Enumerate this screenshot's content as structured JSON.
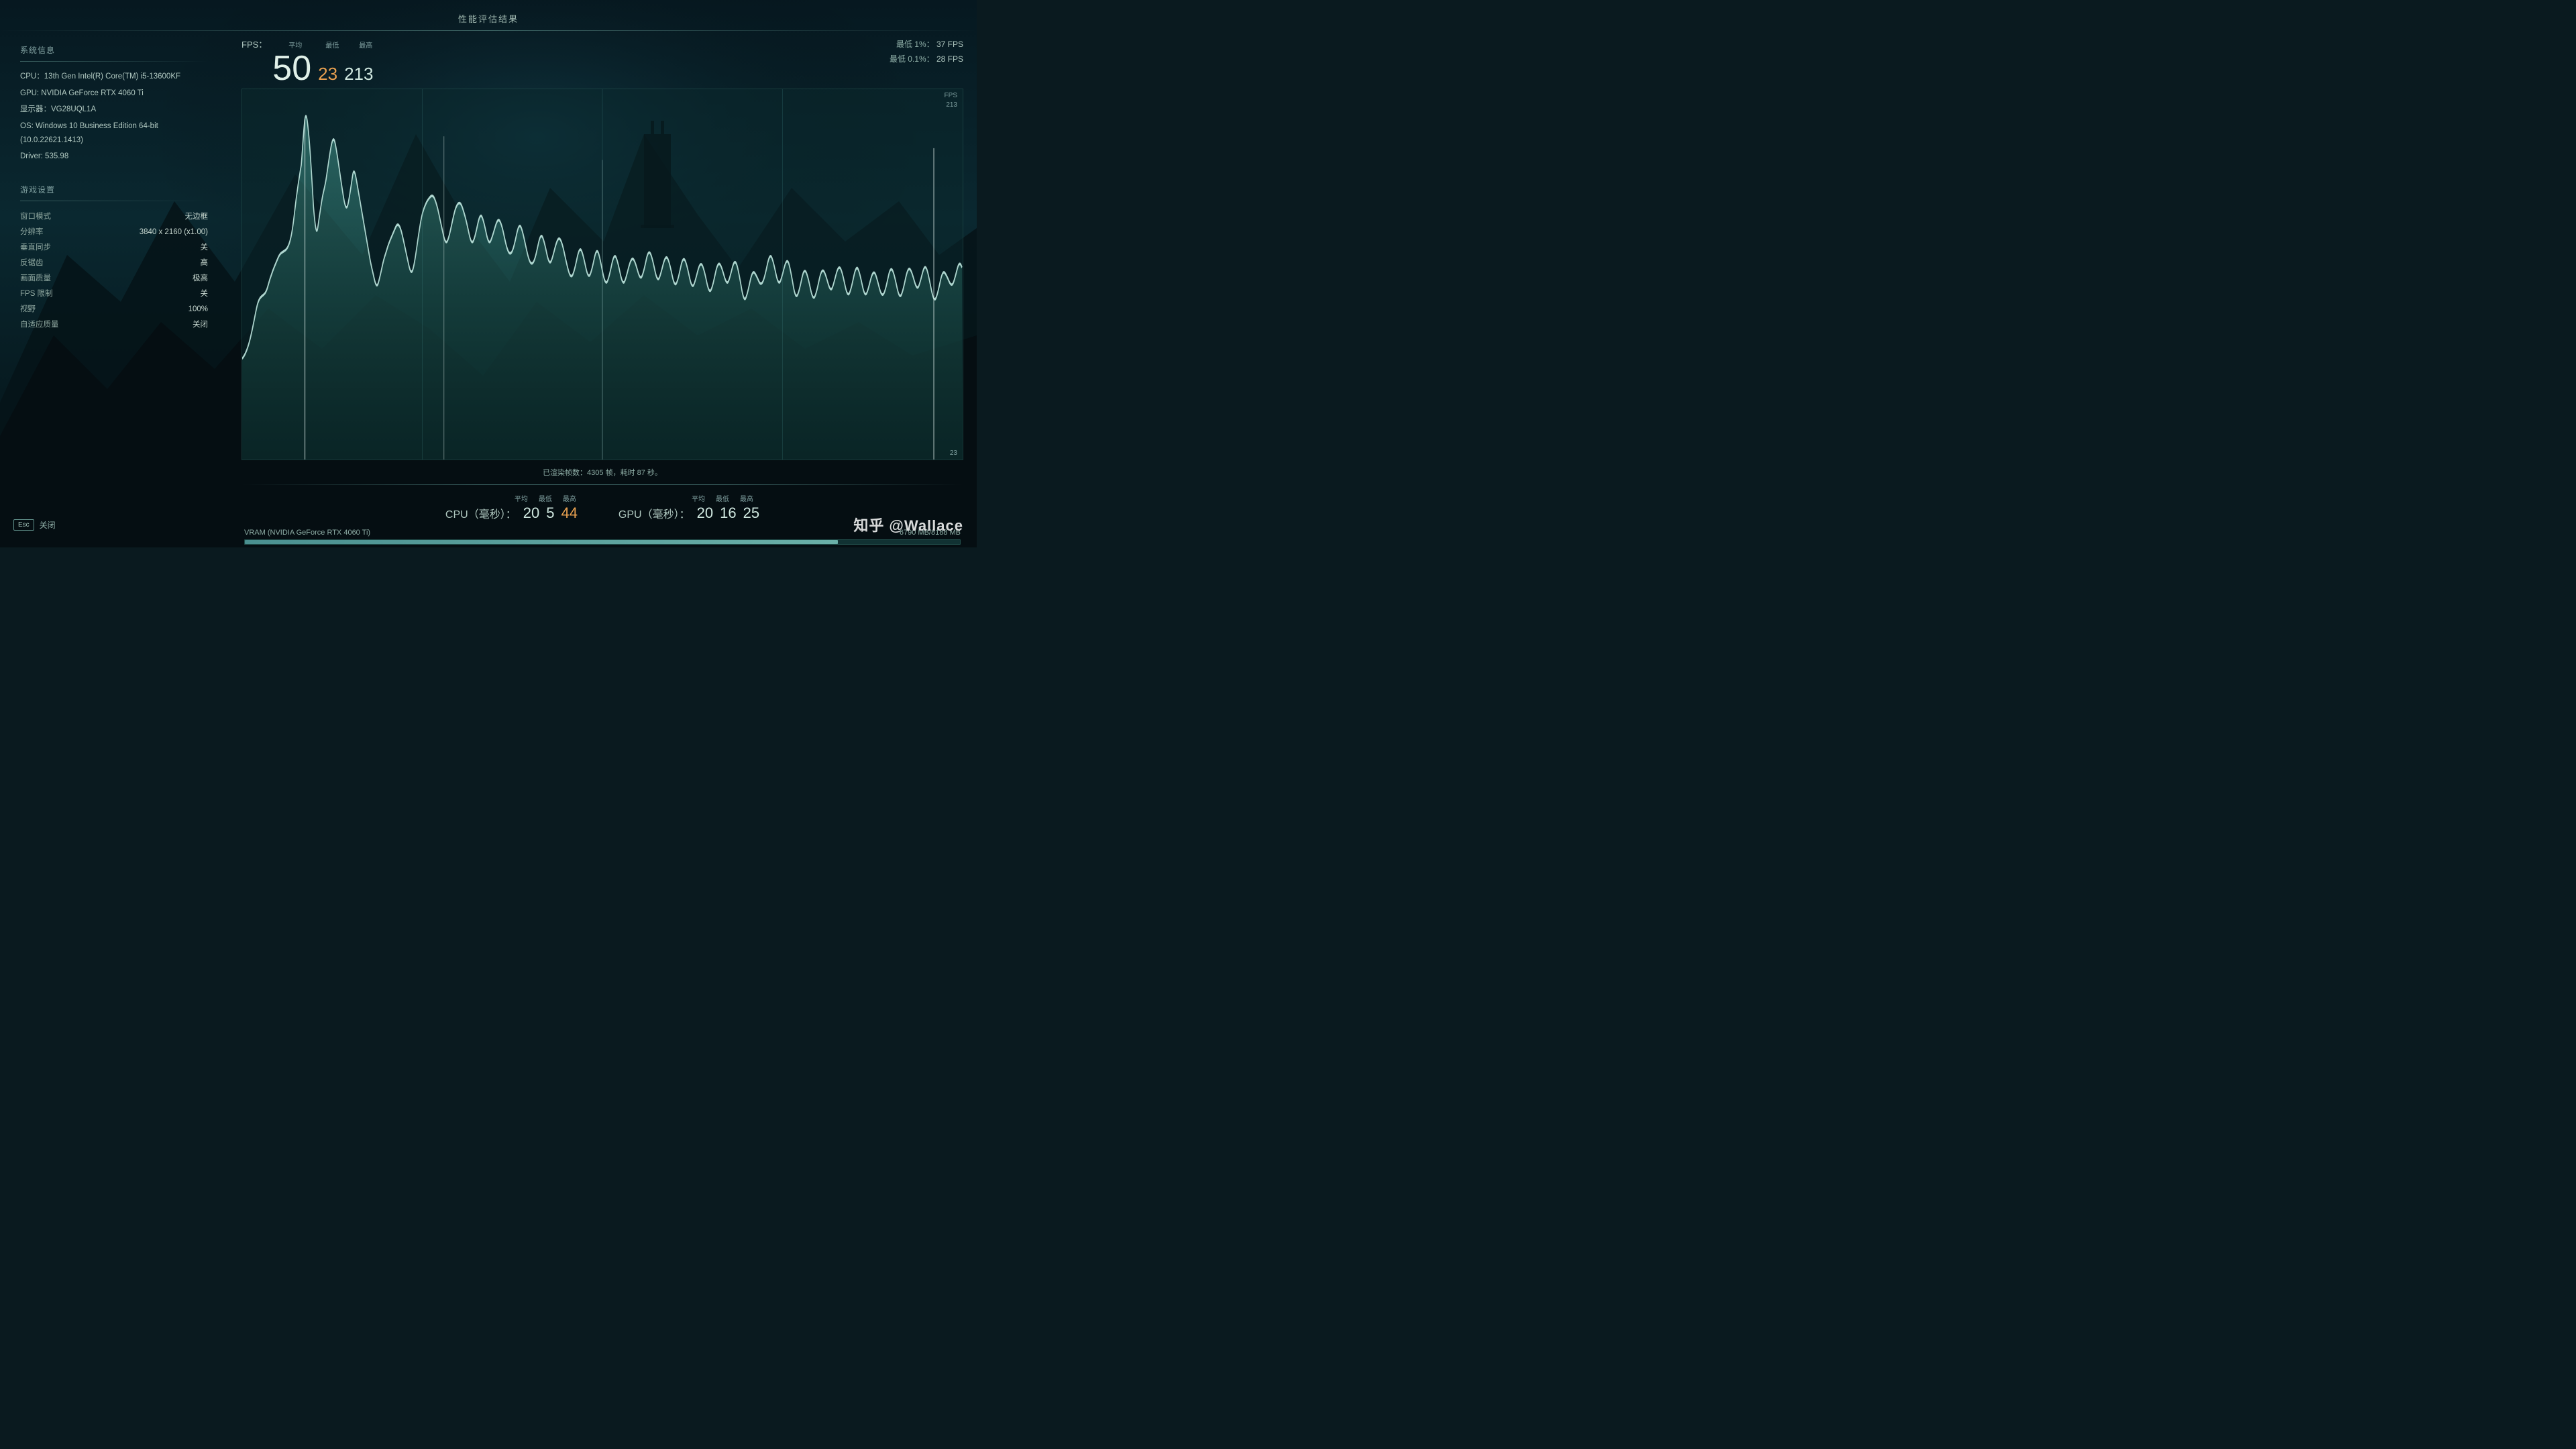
{
  "title": "性能评估结果",
  "system_info": {
    "section_title": "系统信息",
    "cpu": "CPU：13th Gen Intel(R) Core(TM) i5-13600KF",
    "gpu": "GPU: NVIDIA GeForce RTX 4060 Ti",
    "display": "显示器：VG28UQL1A",
    "os": "OS: Windows 10 Business Edition 64-bit (10.0.22621.1413)",
    "driver": "Driver: 535.98"
  },
  "game_settings": {
    "section_title": "游戏设置",
    "rows": [
      {
        "label": "窗口模式",
        "value": "无边框"
      },
      {
        "label": "分辨率",
        "value": "3840 x 2160 (x1.00)"
      },
      {
        "label": "垂直同步",
        "value": "关"
      },
      {
        "label": "反锯齿",
        "value": "高"
      },
      {
        "label": "画面质量",
        "value": "极高"
      },
      {
        "label": "FPS 限制",
        "value": "关"
      },
      {
        "label": "视野",
        "value": "100%"
      },
      {
        "label": "自适应质量",
        "value": "关闭"
      }
    ]
  },
  "fps_stats": {
    "label": "FPS：",
    "headers": {
      "avg": "平均",
      "min": "最低",
      "max": "最高"
    },
    "avg": "50",
    "min": "23",
    "max": "213",
    "low1pct_label": "最低 1%：",
    "low1pct": "37 FPS",
    "low01pct_label": "最低 0.1%：",
    "low01pct": "28 FPS",
    "chart_fps_label": "FPS",
    "chart_max": "213",
    "chart_min": "23"
  },
  "rendered_info": "已渲染帧数：4305 帧，耗时 87 秒。",
  "cpu_stats": {
    "label": "CPU（毫秒）：",
    "headers": {
      "avg": "平均",
      "min": "最低",
      "max": "最高"
    },
    "avg": "20",
    "min": "5",
    "max": "44"
  },
  "gpu_stats": {
    "label": "GPU（毫秒）：",
    "headers": {
      "avg": "平均",
      "min": "最低",
      "max": "最高"
    },
    "avg": "20",
    "min": "16",
    "max": "25"
  },
  "vram": {
    "label": "VRAM (NVIDIA GeForce RTX 4060 Ti)",
    "used": "6790 MB/8188 MB",
    "fill_pct": 82.9
  },
  "bottom": {
    "esc_key": "Esc",
    "close_label": "关闭",
    "watermark": "知乎 @Wallace"
  }
}
